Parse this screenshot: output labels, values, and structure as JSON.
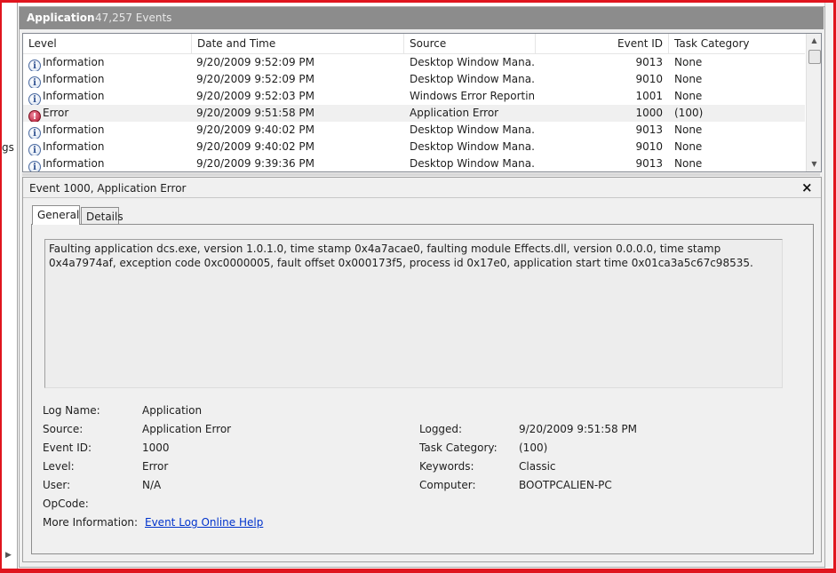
{
  "left_strip": {
    "partial_text": "gs"
  },
  "header": {
    "title": "Application",
    "count": "47,257 Events"
  },
  "columns": {
    "level": "Level",
    "date_time": "Date and Time",
    "source": "Source",
    "event_id": "Event ID",
    "task_category": "Task Category"
  },
  "events": [
    {
      "level": "Information",
      "level_icon": "info-icon",
      "date_time": "9/20/2009 9:52:09 PM",
      "source": "Desktop Window Mana...",
      "event_id": "9013",
      "task_category": "None"
    },
    {
      "level": "Information",
      "level_icon": "info-icon",
      "date_time": "9/20/2009 9:52:09 PM",
      "source": "Desktop Window Mana...",
      "event_id": "9010",
      "task_category": "None"
    },
    {
      "level": "Information",
      "level_icon": "info-icon",
      "date_time": "9/20/2009 9:52:03 PM",
      "source": "Windows Error Reporting",
      "event_id": "1001",
      "task_category": "None"
    },
    {
      "level": "Error",
      "level_icon": "error-icon",
      "date_time": "9/20/2009 9:51:58 PM",
      "source": "Application Error",
      "event_id": "1000",
      "task_category": "(100)"
    },
    {
      "level": "Information",
      "level_icon": "info-icon",
      "date_time": "9/20/2009 9:40:02 PM",
      "source": "Desktop Window Mana...",
      "event_id": "9013",
      "task_category": "None"
    },
    {
      "level": "Information",
      "level_icon": "info-icon",
      "date_time": "9/20/2009 9:40:02 PM",
      "source": "Desktop Window Mana...",
      "event_id": "9010",
      "task_category": "None"
    },
    {
      "level": "Information",
      "level_icon": "info-icon",
      "date_time": "9/20/2009 9:39:36 PM",
      "source": "Desktop Window Mana...",
      "event_id": "9013",
      "task_category": "None"
    }
  ],
  "detail": {
    "title": "Event 1000, Application Error",
    "close_icon": "×",
    "tabs": {
      "general": "General",
      "details": "Details"
    },
    "description": "Faulting application dcs.exe, version 1.0.1.0, time stamp 0x4a7acae0, faulting module Effects.dll, version 0.0.0.0, time stamp 0x4a7974af, exception code 0xc0000005, fault offset 0x000173f5, process id 0x17e0, application start time 0x01ca3a5c67c98535.",
    "labels": {
      "log_name": "Log Name:",
      "source": "Source:",
      "event_id": "Event ID:",
      "level": "Level:",
      "user": "User:",
      "opcode": "OpCode:",
      "more_info": "More Information:",
      "logged": "Logged:",
      "task_category": "Task Category:",
      "keywords": "Keywords:",
      "computer": "Computer:"
    },
    "values": {
      "log_name": "Application",
      "source": "Application Error",
      "event_id": "1000",
      "level": "Error",
      "user": "N/A",
      "opcode": "",
      "more_info_link": "Event Log Online Help",
      "logged": "9/20/2009 9:51:58 PM",
      "task_category": "(100)",
      "keywords": "Classic",
      "computer": "BOOTPCALIEN-PC"
    }
  },
  "colors": {
    "frame": "#e0151e",
    "header_bar": "#8c8c8c",
    "link": "#0033cc",
    "error_icon": "#b0122c",
    "info_icon": "#2d4f8f"
  }
}
